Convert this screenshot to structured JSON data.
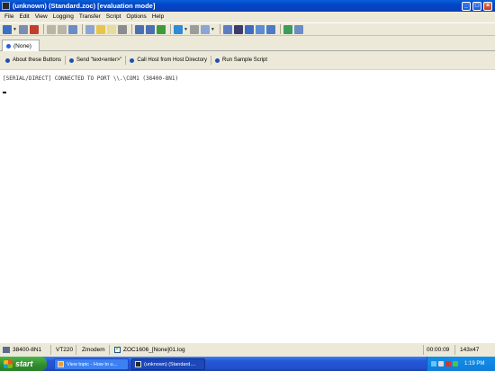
{
  "window": {
    "title": "(unknown) (Standard.zoc) [evaluation mode]",
    "minimize": "_",
    "maximize": "□",
    "close": "×"
  },
  "menu": [
    "File",
    "Edit",
    "View",
    "Logging",
    "Transfer",
    "Script",
    "Options",
    "Help"
  ],
  "session_tab": {
    "label": "(None)"
  },
  "quick_buttons": [
    "About these Buttons",
    "Send \"text<enter>\"",
    "Call Host from Host Directory",
    "Run Sample Script"
  ],
  "terminal": {
    "line1": "[SERIAL/DIRECT] CONNECTED TO PORT \\\\.\\COM1 (38400-8N1)"
  },
  "status": {
    "connection": "38400-8N1",
    "emulation": "VT220",
    "transfer": "Zmodem",
    "logfile": "ZOC1606_[None]01.log",
    "elapsed": "00:00:09",
    "size": "143x47"
  },
  "taskbar": {
    "start": "start",
    "tasks": [
      "View topic - How to u...",
      "(unknown) (Standard...."
    ],
    "clock": "1:19 PM"
  },
  "colors": {
    "titlebar": "#0047c8",
    "terminal_bg": "#ffffff",
    "taskbar": "#2457d6",
    "start": "#2f8c2c"
  }
}
